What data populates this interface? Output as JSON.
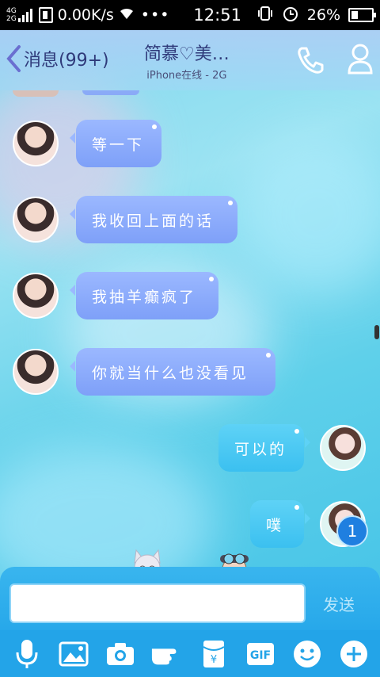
{
  "status_bar": {
    "net_top": "4G",
    "net_bottom": "2G",
    "speed": "0.00K/s",
    "time": "12:51",
    "battery": "26%"
  },
  "header": {
    "back_label": "消息(99+)",
    "title": "简慕♡美…",
    "subtitle": "iPhone在线 - 2G"
  },
  "messages": [
    {
      "side": "left",
      "text": "等一下"
    },
    {
      "side": "left",
      "text": "我收回上面的话"
    },
    {
      "side": "left",
      "text": "我抽羊癫疯了"
    },
    {
      "side": "left",
      "text": "你就当什么也没看见"
    },
    {
      "side": "right",
      "text": "可以的"
    },
    {
      "side": "right",
      "text": "噗"
    }
  ],
  "unread_badge": "1",
  "input": {
    "value": "",
    "send_label": "发送"
  },
  "toolbar": {
    "gif_label": "GIF",
    "redpacket_symbol": "¥",
    "icons": [
      "microphone-icon",
      "image-icon",
      "camera-icon",
      "poke-icon",
      "red-packet-icon",
      "gif-icon",
      "emoji-icon",
      "plus-icon"
    ]
  }
}
